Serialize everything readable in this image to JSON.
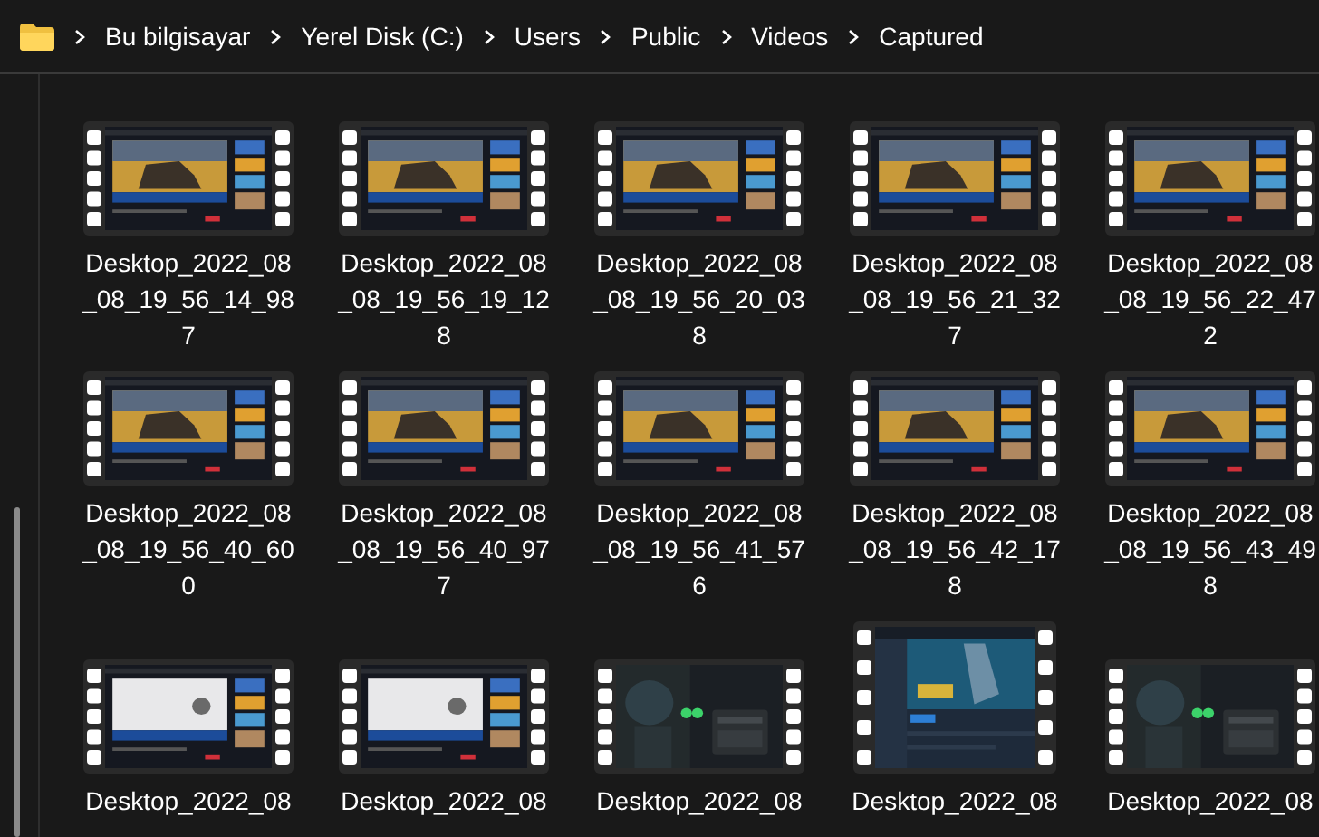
{
  "breadcrumb": [
    "Bu bilgisayar",
    "Yerel Disk (C:)",
    "Users",
    "Public",
    "Videos",
    "Captured"
  ],
  "files": [
    {
      "name_lines": [
        "Desktop_2022_08",
        "_08_19_56_14_98",
        "7"
      ],
      "tall": false
    },
    {
      "name_lines": [
        "Desktop_2022_08",
        "_08_19_56_19_12",
        "8"
      ],
      "tall": false
    },
    {
      "name_lines": [
        "Desktop_2022_08",
        "_08_19_56_20_03",
        "8"
      ],
      "tall": false
    },
    {
      "name_lines": [
        "Desktop_2022_08",
        "_08_19_56_21_32",
        "7"
      ],
      "tall": false
    },
    {
      "name_lines": [
        "Desktop_2022_08",
        "_08_19_56_22_47",
        "2"
      ],
      "tall": false
    },
    {
      "name_lines": [
        "Desktop_2022_08",
        "_08_19_56_40_60",
        "0"
      ],
      "tall": false
    },
    {
      "name_lines": [
        "Desktop_2022_08",
        "_08_19_56_40_97",
        "7"
      ],
      "tall": false
    },
    {
      "name_lines": [
        "Desktop_2022_08",
        "_08_19_56_41_57",
        "6"
      ],
      "tall": false
    },
    {
      "name_lines": [
        "Desktop_2022_08",
        "_08_19_56_42_17",
        "8"
      ],
      "tall": false
    },
    {
      "name_lines": [
        "Desktop_2022_08",
        "_08_19_56_43_49",
        "8"
      ],
      "tall": false
    },
    {
      "name_lines": [
        "Desktop_2022_08"
      ],
      "tall": false
    },
    {
      "name_lines": [
        "Desktop_2022_08"
      ],
      "tall": false
    },
    {
      "name_lines": [
        "Desktop_2022_08"
      ],
      "tall": false
    },
    {
      "name_lines": [
        "Desktop_2022_08"
      ],
      "tall": true
    },
    {
      "name_lines": [
        "Desktop_2022_08"
      ],
      "tall": false
    }
  ]
}
